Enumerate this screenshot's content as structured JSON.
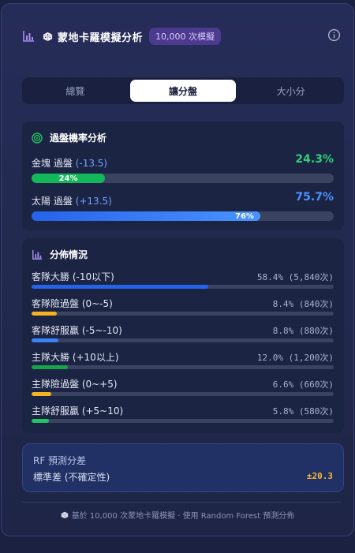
{
  "header": {
    "title": "蒙地卡羅模擬分析",
    "badge": "10,000 次模擬"
  },
  "tabs": [
    {
      "label": "總覽",
      "active": false
    },
    {
      "label": "讓分盤",
      "active": true
    },
    {
      "label": "大小分",
      "active": false
    }
  ],
  "cover": {
    "title": "過盤機率分析",
    "rows": [
      {
        "team": "金塊",
        "suffix": "過盤",
        "line": "(-13.5)",
        "value": "24.3%",
        "bar_label": "24%",
        "percent": 24.3,
        "color": "#12b85a",
        "value_color": "#2bd27a"
      },
      {
        "team": "太陽",
        "suffix": "過盤",
        "line": "(+13.5)",
        "value": "75.7%",
        "bar_label": "76%",
        "percent": 75.7,
        "color": "#2f7df2",
        "value_color": "#4a93ff"
      }
    ]
  },
  "distribution": {
    "title": "分佈情況",
    "rows": [
      {
        "label": "客隊大勝 (-10以下)",
        "value": "58.4% (5,840次)",
        "percent": 58.4,
        "color": "#2563eb"
      },
      {
        "label": "客隊險過盤 (0~-5)",
        "value": "8.4% (840次)",
        "percent": 8.4,
        "color": "#f5b324"
      },
      {
        "label": "客隊舒服贏 (-5~-10)",
        "value": "8.8% (880次)",
        "percent": 8.8,
        "color": "#3b82f6"
      },
      {
        "label": "主隊大勝 (+10以上)",
        "value": "12.0% (1,200次)",
        "percent": 12.0,
        "color": "#16a34a"
      },
      {
        "label": "主隊險過盤 (0~+5)",
        "value": "6.6% (660次)",
        "percent": 6.6,
        "color": "#f5b324"
      },
      {
        "label": "主隊舒服贏 (+5~10)",
        "value": "5.8% (580次)",
        "percent": 5.8,
        "color": "#22c55e"
      }
    ]
  },
  "rf": {
    "title": "RF 預測分差",
    "std_label": "標準差 (不確定性)",
    "std_value": "±20.3"
  },
  "footer": {
    "text": "基於 10,000 次蒙地卡羅模擬 · 使用 Random Forest 預測分佈"
  },
  "icons": {
    "header_chart": "bar-chart-icon",
    "dice": "dice-icon",
    "info": "info-icon",
    "target": "target-icon",
    "distribution": "bar-chart-icon"
  }
}
